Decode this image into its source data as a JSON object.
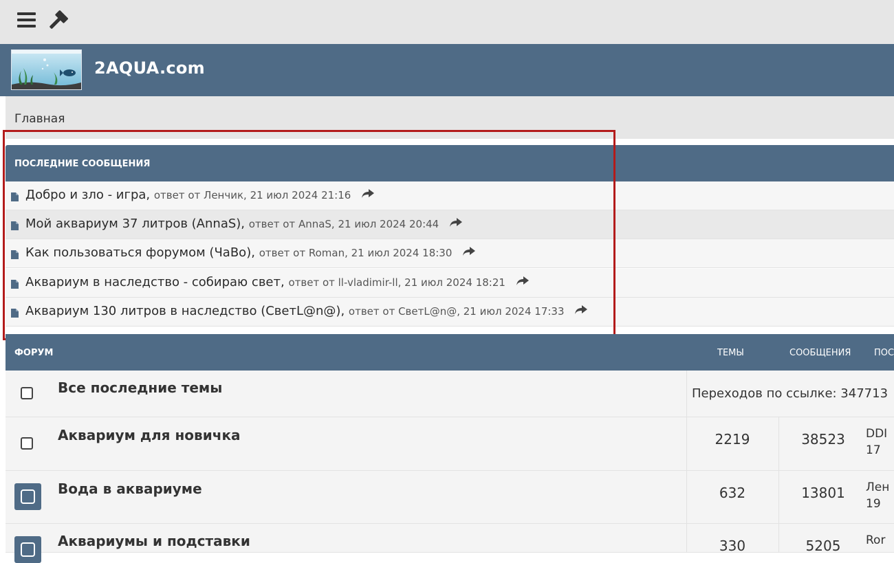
{
  "site": {
    "name": "2AQUA.com"
  },
  "breadcrumb": {
    "home": "Главная"
  },
  "latest": {
    "heading": "ПОСЛЕДНИЕ СООБЩЕНИЯ",
    "posts": [
      {
        "title": "Добро и зло - игра",
        "meta": "ответ от Ленчик, 21 июл 2024 21:16"
      },
      {
        "title": "Мой аквариум 37 литров (AnnaS)",
        "meta": "ответ от AnnaS, 21 июл 2024 20:44"
      },
      {
        "title": "Как пользоваться форумом (ЧаВо)",
        "meta": "ответ от Roman, 21 июл 2024 18:30"
      },
      {
        "title": "Аквариум в наследство - собираю свет",
        "meta": "ответ от ll-vladimir-ll, 21 июл 2024 18:21"
      },
      {
        "title": "Аквариум 130 литров в наследство (СветL@n@)",
        "meta": "ответ от СветL@n@, 21 июл 2024 17:33"
      }
    ]
  },
  "forum": {
    "col_forum": "ФОРУМ",
    "col_topics": "ТЕМЫ",
    "col_messages": "СООБЩЕНИЯ",
    "col_last": "ПОС",
    "rows": [
      {
        "name": "Все последние темы",
        "redirect": "Переходов по ссылке: 347713"
      },
      {
        "name": "Аквариум для новичка",
        "topics": "2219",
        "messages": "38523",
        "last_line1": "DDI",
        "last_line2": "17"
      },
      {
        "name": "Вода в аквариуме",
        "topics": "632",
        "messages": "13801",
        "last_line1": "Лен",
        "last_line2": "19"
      },
      {
        "name": "Аквариумы и подставки",
        "topics": "330",
        "messages": "5205",
        "last_line1": "Ror",
        "last_line2": ""
      }
    ]
  },
  "colors": {
    "header": "#4f6b86",
    "highlight": "#b31b1b",
    "topbar": "#e6e6e6"
  }
}
